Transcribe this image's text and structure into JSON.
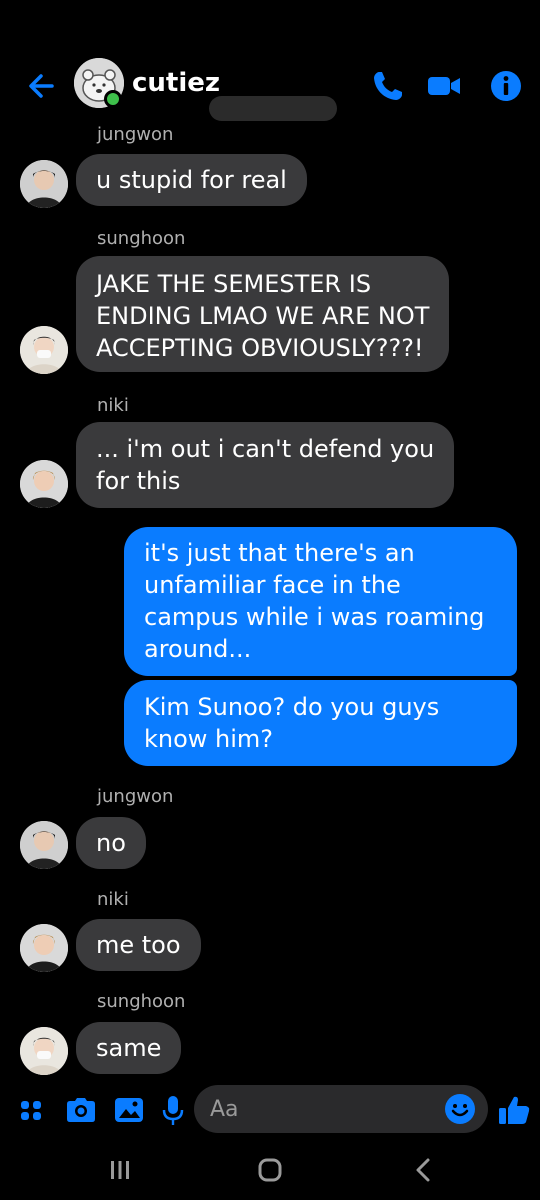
{
  "header": {
    "title": "cutiez",
    "back_icon": "back-arrow-icon",
    "actions": [
      "phone-icon",
      "video-camera-icon",
      "info-icon"
    ],
    "accent_color": "#0a7cff"
  },
  "messages": [
    {
      "sender": "jungwon",
      "text": [
        "u stupid for real"
      ],
      "direction": "incoming"
    },
    {
      "sender": "sunghoon",
      "text": [
        "JAKE THE SEMESTER IS",
        "ENDING LMAO WE ARE NOT",
        "ACCEPTING OBVIOUSLY???!"
      ],
      "direction": "incoming"
    },
    {
      "sender": "niki",
      "text": [
        "... i'm out i can't defend you",
        "for this"
      ],
      "direction": "incoming"
    },
    {
      "sender": "",
      "text": [
        "it's just that there's an",
        "unfamiliar face in the",
        "campus while i was roaming",
        "around..."
      ],
      "direction": "outgoing"
    },
    {
      "sender": "",
      "text": [
        "Kim Sunoo? do you guys",
        "know him?"
      ],
      "direction": "outgoing"
    },
    {
      "sender": "jungwon",
      "text": [
        "no"
      ],
      "direction": "incoming"
    },
    {
      "sender": "niki",
      "text": [
        "me too"
      ],
      "direction": "incoming"
    },
    {
      "sender": "sunghoon",
      "text": [
        "same"
      ],
      "direction": "incoming"
    }
  ],
  "composer": {
    "placeholder": "Aa",
    "icons": [
      "menu-dots-icon",
      "camera-icon",
      "gallery-icon",
      "microphone-icon",
      "emoji-icon",
      "thumbs-up-icon"
    ]
  },
  "navbar": {
    "icons": [
      "recent-apps-icon",
      "home-icon",
      "back-icon"
    ]
  }
}
